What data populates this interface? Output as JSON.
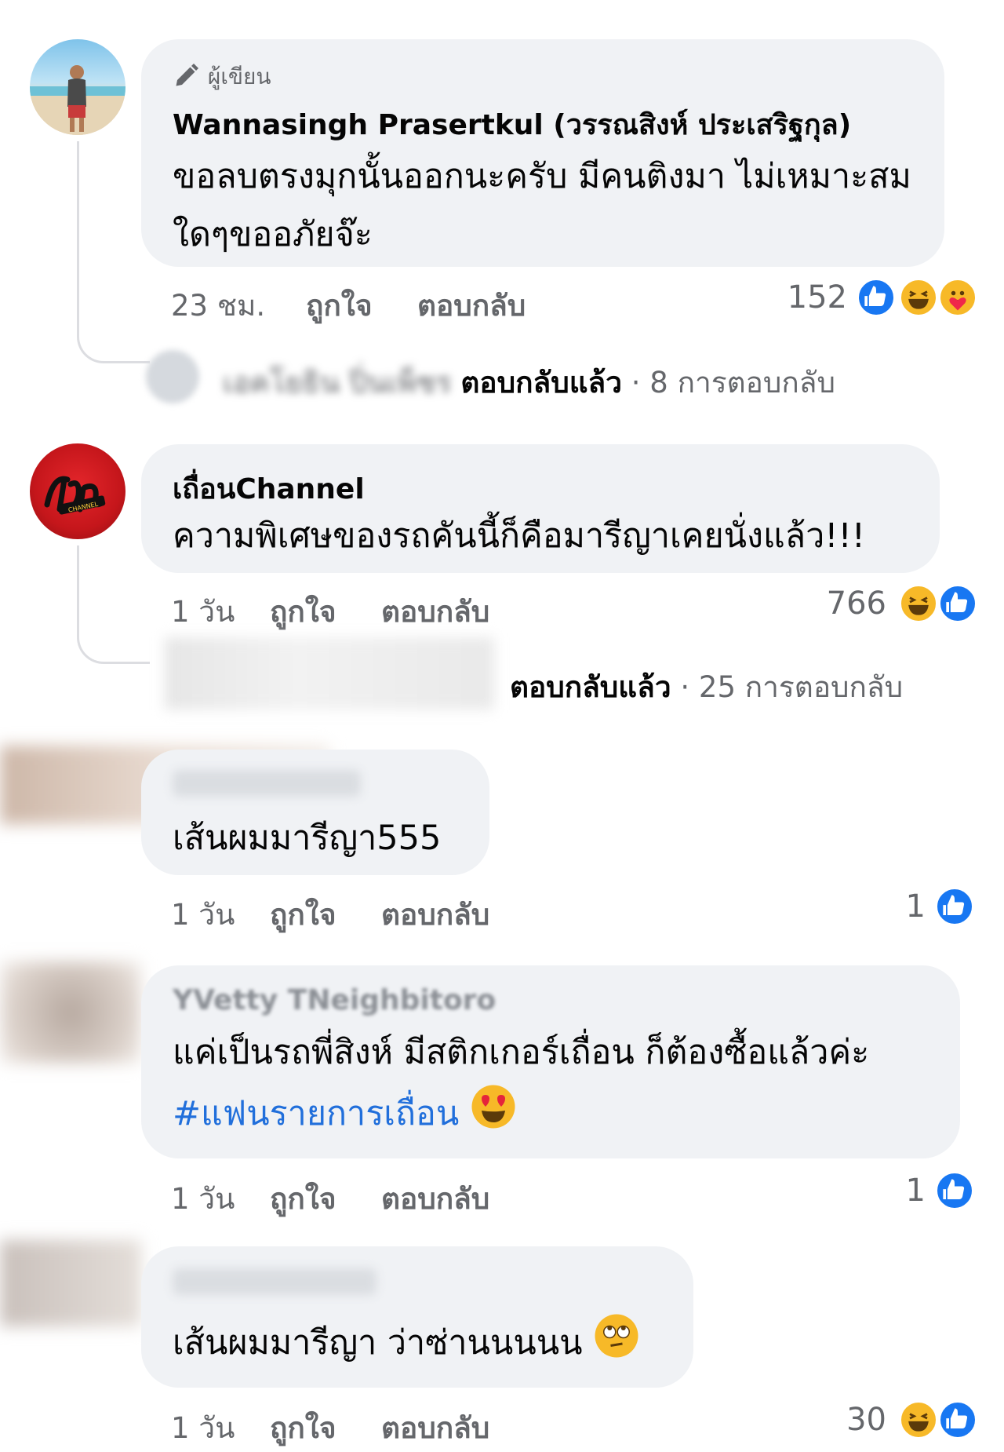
{
  "comments": [
    {
      "author_badge": "ผู้เขียน",
      "author": "Wannasingh Prasertkul (วรรณสิงห์ ประเสริฐกุล)",
      "text": "ขอลบตรงมุกนั้นออกนะครับ มีคนติงมา ไม่เหมาะสมใดๆขออภัยจ๊ะ",
      "time": "23 ชม.",
      "like_label": "ถูกใจ",
      "reply_label": "ตอบกลับ",
      "reaction_count": "152",
      "reactions": [
        "like-icon",
        "haha-icon",
        "care-icon"
      ],
      "replied_by": "เอคโยธิน ปิ่นเพ็ชร",
      "replied_label": "ตอบกลับแล้ว",
      "replies_count": "· 8 การตอบกลับ"
    },
    {
      "author": "เถื่อนChannel",
      "text": "ความพิเศษของรถคันนี้ก็คือมารีญาเคยนั่งแล้ว!!!",
      "time": "1 วัน",
      "like_label": "ถูกใจ",
      "reply_label": "ตอบกลับ",
      "reaction_count": "766",
      "reactions": [
        "haha-icon",
        "like-icon"
      ],
      "replied_label": "ตอบกลับแล้ว",
      "replies_count": "· 25 การตอบกลับ"
    },
    {
      "text": "เส้นผมมารีญา555",
      "time": "1 วัน",
      "like_label": "ถูกใจ",
      "reply_label": "ตอบกลับ",
      "reaction_count": "1",
      "reactions": [
        "like-icon"
      ]
    },
    {
      "author": "YVetty TNeighbitoro",
      "text": "แค่เป็นรถพี่สิงห์ มีสติกเกอร์เถื่อน ก็ต้องซื้อแล้วค่ะ",
      "hashtag": "#แฟนรายการเถื่อน",
      "time": "1 วัน",
      "like_label": "ถูกใจ",
      "reply_label": "ตอบกลับ",
      "reaction_count": "1",
      "reactions": [
        "like-icon"
      ]
    },
    {
      "text": "เส้นผมมารีญา ว่าซ่านนนนน",
      "time": "1 วัน",
      "like_label": "ถูกใจ",
      "reply_label": "ตอบกลับ",
      "reaction_count": "30",
      "reactions": [
        "haha-icon",
        "like-icon"
      ]
    }
  ],
  "colors": {
    "bubble": "#f0f2f5",
    "meta": "#65676b",
    "like_blue": "#1877f2",
    "hashtag": "#216fdb",
    "haha_yellow": "#f7b928",
    "channel_red": "#d3181e"
  }
}
